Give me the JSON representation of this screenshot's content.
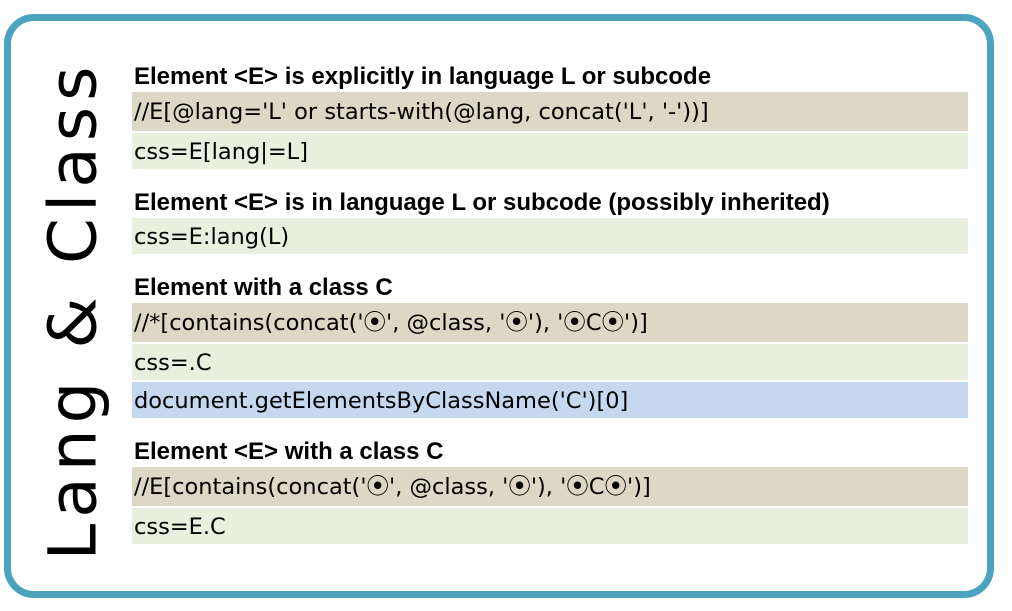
{
  "side_title": "Lang & Class",
  "colors": {
    "frame_border": "#4aa3bf",
    "xpath_row": "#dcd8c5",
    "css_row": "#e9f0dd",
    "js_row": "#c6d8ef"
  },
  "sections": [
    {
      "title": "Element <E> is explicitly in language L or subcode",
      "rows": [
        {
          "type": "xpath",
          "text": "//E[@lang='L' or starts-with(@lang, concat('L', '-'))]"
        },
        {
          "type": "css",
          "text": "css=E[lang|=L]"
        }
      ]
    },
    {
      "title": "Element <E> is in language L or subcode (possibly inherited)",
      "rows": [
        {
          "type": "css",
          "text": "css=E:lang(L)"
        }
      ]
    },
    {
      "title": "Element with a class C",
      "rows": [
        {
          "type": "xpath",
          "text": "//*[contains(concat('⦿', @class, '⦿'), '⦿C⦿')]"
        },
        {
          "type": "css",
          "text": "css=.C"
        },
        {
          "type": "js",
          "text": "document.getElementsByClassName('C')[0]"
        }
      ]
    },
    {
      "title": "Element <E> with a class C",
      "rows": [
        {
          "type": "xpath",
          "text": "//E[contains(concat('⦿', @class, '⦿'), '⦿C⦿')]"
        },
        {
          "type": "css",
          "text": "css=E.C"
        }
      ]
    }
  ]
}
